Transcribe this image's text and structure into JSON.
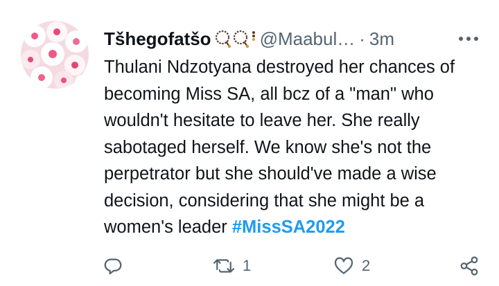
{
  "tweet": {
    "display_name": "Tšhegofatšo",
    "handle": "@Maabul…",
    "separator": "·",
    "time": "3m",
    "text_main": "Thulani Ndzotyana destroyed her chances of becoming Miss SA, all bcz of a \"man\" who wouldn't hesitate to leave her. She really sabotaged herself. We know she's not the perpetrator but she should've made a wise decision, considering that she might be a women's leader ",
    "hashtag": "#MissSA2022"
  },
  "actions": {
    "reply_count": "",
    "retweet_count": "1",
    "like_count": "2"
  },
  "icons": {
    "reply": "reply-bubble-icon",
    "retweet": "retweet-icon",
    "like": "heart-icon",
    "share": "share-icon",
    "more": "more-dots-icon"
  },
  "colors": {
    "text": "#0f1419",
    "secondary": "#536471",
    "link": "#1d9bf0",
    "background": "#ffffff"
  }
}
